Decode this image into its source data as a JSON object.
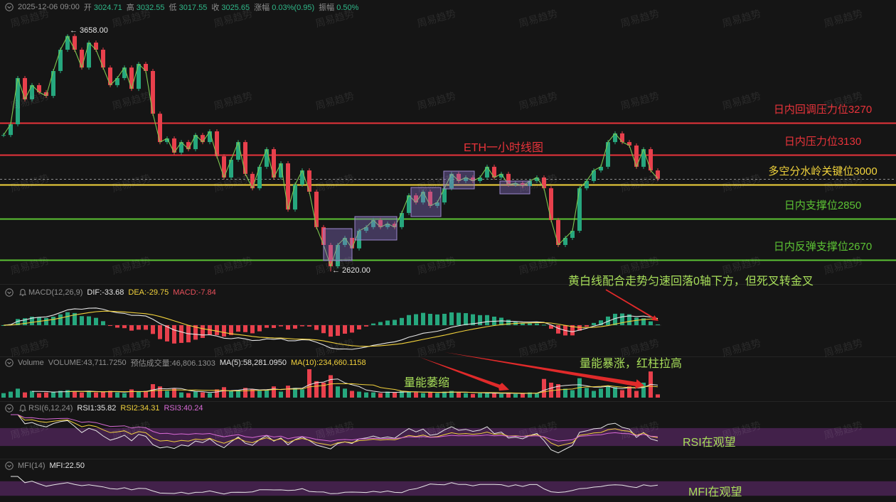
{
  "header": {
    "datetime": "2025-12-06 09:00",
    "open_label": "开",
    "open": "3024.71",
    "high_label": "高",
    "high": "3032.55",
    "low_label": "低",
    "low": "3017.55",
    "close_label": "收",
    "close": "3025.65",
    "change_label": "涨幅",
    "change": "0.03%(0.95)",
    "amplitude_label": "振幅",
    "amplitude": "0.50%"
  },
  "watermark": "周易趋势",
  "price_panel": {
    "high_marker": "← 3658.00",
    "low_marker": "← 2620.00"
  },
  "macd_panel": {
    "name": "MACD(12,26,9)",
    "dif": "DIF:-33.68",
    "dea": "DEA:-29.75",
    "macd": "MACD:-7.84",
    "annotation": "黄白线配合走势匀速回落0轴下方，但死叉转金叉"
  },
  "volume_panel": {
    "name": "Volume",
    "volume": "VOLUME:43,711.7250",
    "estimate": "预估成交量:46,806.1303",
    "ma5": "MA(5):58,281.0950",
    "ma10": "MA(10):234,660.1158",
    "annotation_left": "量能萎缩",
    "annotation_right": "量能暴涨，红柱拉高"
  },
  "rsi_panel": {
    "name": "RSI(6,12,24)",
    "rsi1": "RSI1:35.82",
    "rsi2": "RSI2:34.31",
    "rsi3": "RSI3:40.24",
    "annotation": "RSI在观望"
  },
  "mfi_panel": {
    "name": "MFI(14)",
    "mfi": "MFI:22.50",
    "annotation": "MFI在观望"
  },
  "colors": {
    "up": "#26a77e",
    "down": "#e8404c",
    "price_line": "#7ec850",
    "dif": "#e6e6e6",
    "dea": "#f2d23c",
    "rsi3": "#d86ad6",
    "band": "#4a2353",
    "arrow": "#e02a2a"
  },
  "chart_data": {
    "type": "line",
    "title": "ETH一小时线图",
    "close": [
      3217,
      3264,
      3466,
      3373,
      3435,
      3404,
      3388,
      3497,
      3590,
      3650,
      3590,
      3512,
      3621,
      3590,
      3512,
      3435,
      3466,
      3512,
      3419,
      3528,
      3497,
      3310,
      3186,
      3202,
      3140,
      3186,
      3155,
      3217,
      3186,
      3233,
      3124,
      3031,
      3109,
      3186,
      3047,
      2984,
      3078,
      3155,
      3031,
      3093,
      2891,
      3000,
      3062,
      2969,
      2814,
      2736,
      2643,
      2736,
      2767,
      2721,
      2798,
      2814,
      2845,
      2814,
      2829,
      2814,
      2876,
      2953,
      2922,
      2969,
      2907,
      2922,
      2984,
      3047,
      3016,
      3031,
      3016,
      3031,
      3078,
      3031,
      3047,
      3000,
      3006,
      2994,
      3016,
      3031,
      2984,
      2845,
      2736,
      2767,
      2798,
      2984,
      3016,
      3062,
      3078,
      3186,
      3224,
      3186,
      3171,
      3078,
      3155,
      3062,
      3025.65
    ],
    "volume": [
      60000,
      80000,
      120000,
      70000,
      90000,
      60000,
      70000,
      80000,
      90000,
      100000,
      80000,
      70000,
      90000,
      70000,
      80000,
      90000,
      70000,
      60000,
      110000,
      80000,
      90000,
      180000,
      150000,
      90000,
      120000,
      70000,
      60000,
      80000,
      70000,
      60000,
      110000,
      140000,
      90000,
      100000,
      130000,
      110000,
      90000,
      100000,
      150000,
      80000,
      160000,
      130000,
      110000,
      380000,
      220000,
      200000,
      300000,
      150000,
      120000,
      90000,
      80000,
      70000,
      70000,
      60000,
      80000,
      70000,
      90000,
      80000,
      70000,
      60000,
      70000,
      60000,
      80000,
      90000,
      70000,
      60000,
      50000,
      60000,
      70000,
      60000,
      50000,
      60000,
      50000,
      60000,
      70000,
      60000,
      250000,
      200000,
      180000,
      120000,
      100000,
      260000,
      130000,
      90000,
      120000,
      160000,
      140000,
      100000,
      150000,
      90000,
      200000,
      350000,
      43711.725
    ],
    "price_high": 3658.0,
    "price_low": 2620.0,
    "last_close": 3025.65,
    "levels": [
      {
        "label": "日内回调压力位3270",
        "value": 3270,
        "color": "#e8333a"
      },
      {
        "label": "日内压力位3130",
        "value": 3130,
        "color": "#e8333a"
      },
      {
        "label": "多空分水岭关键位3000",
        "value": 3000,
        "color": "#f2d43c"
      },
      {
        "label": "日内支撑位2850",
        "value": 2850,
        "color": "#5cc234"
      },
      {
        "label": "日内反弹支撑位2670",
        "value": 2670,
        "color": "#5cc234"
      }
    ],
    "indicators": {
      "macd": [
        12,
        26,
        9
      ],
      "volume_ma": [
        5,
        10
      ],
      "rsi": [
        6,
        12,
        24
      ],
      "mfi": 14
    },
    "rsi_band": [
      30,
      70
    ],
    "mfi_band": [
      20,
      80
    ]
  }
}
